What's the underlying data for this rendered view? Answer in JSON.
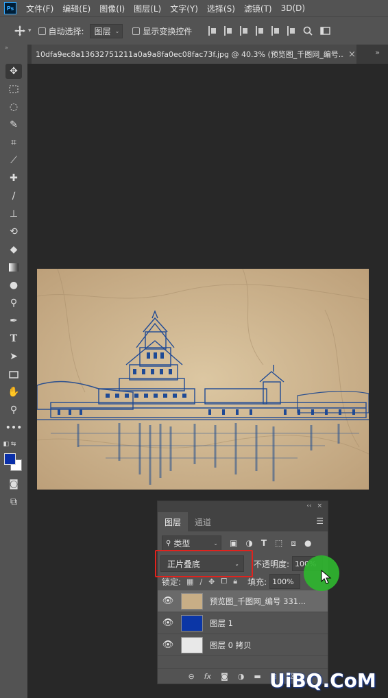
{
  "menubar": {
    "logo": "Ps",
    "items": [
      "文件(F)",
      "编辑(E)",
      "图像(I)",
      "图层(L)",
      "文字(Y)",
      "选择(S)",
      "滤镜(T)",
      "3D(D)"
    ]
  },
  "options": {
    "auto_select_label": "自动选择:",
    "auto_select_value": "图层",
    "show_transform_label": "显示变换控件"
  },
  "document": {
    "tab_title": "10dfa9ec8a13632751211a0a9a8fa0ec08fac73f.jpg @ 40.3% (预览图_千图网_编号...",
    "close": "×",
    "more": "»"
  },
  "layers_panel": {
    "collapse": "‹‹",
    "close": "×",
    "tabs": [
      "图层",
      "通道"
    ],
    "filter_value": "类型",
    "blend_mode": "正片叠底",
    "opacity_label": "不透明度:",
    "opacity_value": "100%",
    "lock_label": "锁定:",
    "fill_label": "填充:",
    "fill_value": "100%",
    "layers": [
      {
        "name": "预览图_千图网_编号 331...",
        "thumb_color": "#c8ae86",
        "selected": true
      },
      {
        "name": "图层 1",
        "thumb_color": "#0b36a6",
        "selected": false
      },
      {
        "name": "图层 0 拷贝",
        "thumb_color": "#e8e8e8",
        "selected": false
      }
    ],
    "footer_icons": [
      "link-icon",
      "fx-icon",
      "mask-icon",
      "adjustment-icon",
      "folder-icon",
      "new-layer-icon",
      "trash-icon"
    ],
    "footer_fx": "fx"
  },
  "colors": {
    "foreground": "#0a2fa8",
    "background": "#ffffff",
    "highlight": "#e0231e",
    "cursor": "#2fb52f"
  },
  "watermark": "UiBQ.CoM"
}
